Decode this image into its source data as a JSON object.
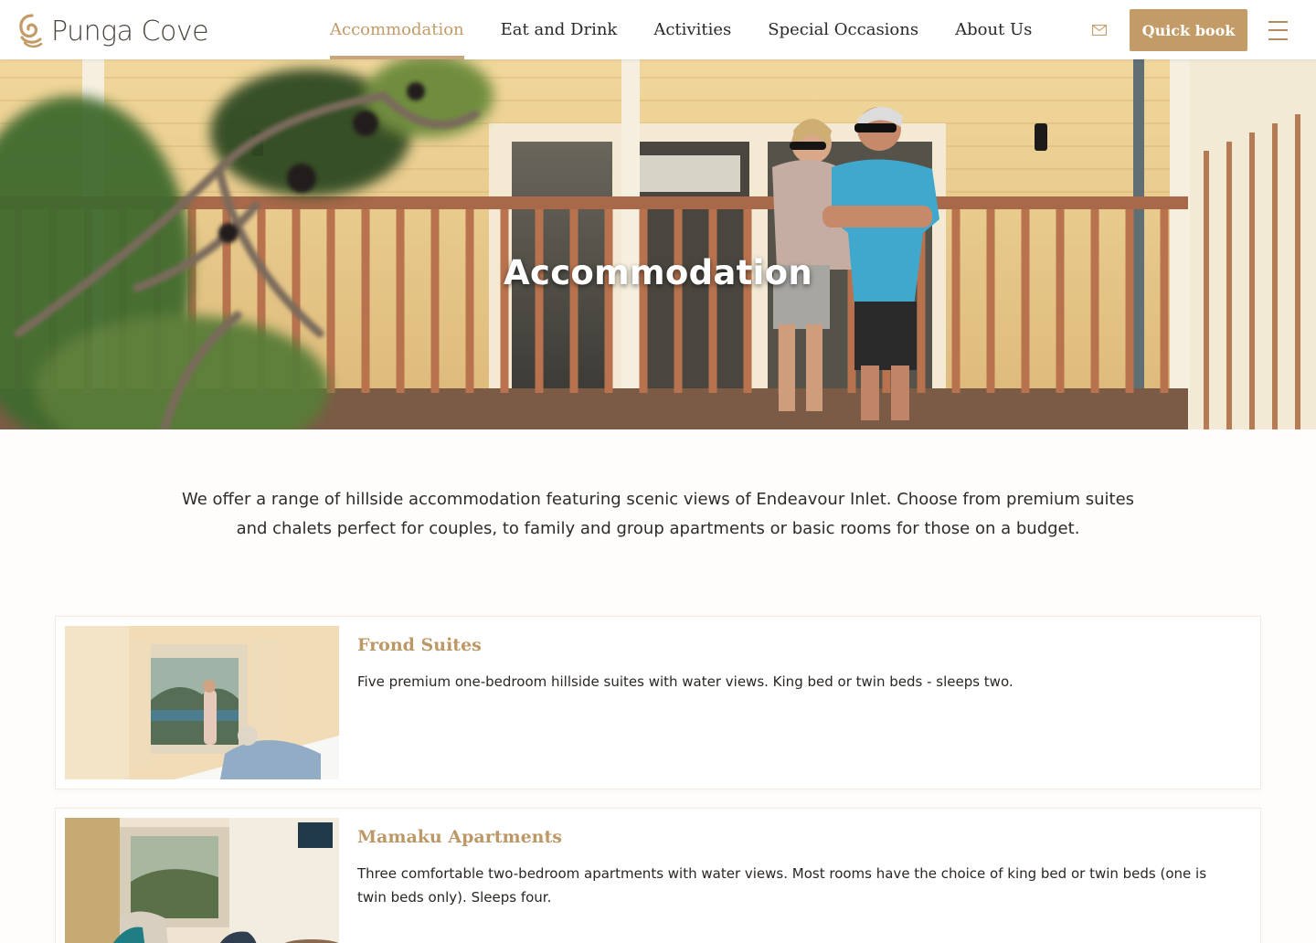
{
  "brand": {
    "name": "Punga Cove",
    "accent_color": "#c39b67"
  },
  "nav": {
    "items": [
      {
        "label": "Accommodation",
        "active": true
      },
      {
        "label": "Eat and Drink",
        "active": false
      },
      {
        "label": "Activities",
        "active": false
      },
      {
        "label": "Special Occasions",
        "active": false
      },
      {
        "label": "About Us",
        "active": false
      }
    ]
  },
  "header": {
    "mail_icon": "envelope-icon",
    "quick_book_label": "Quick book",
    "menu_icon": "hamburger-menu-icon"
  },
  "hero": {
    "title": "Accommodation"
  },
  "intro": {
    "text": "We offer a range of hillside accommodation featuring scenic views of Endeavour Inlet. Choose from premium suites and chalets perfect for couples, to family and group apartments or basic rooms for those on a budget."
  },
  "listings": [
    {
      "title": "Frond Suites",
      "description": "Five premium one-bedroom hillside suites with water views. King bed or twin beds - sleeps two."
    },
    {
      "title": "Mamaku Apartments",
      "description": "Three comfortable two-bedroom apartments with water views. Most rooms have the choice of king bed or twin beds (one is twin beds only). Sleeps four."
    }
  ]
}
